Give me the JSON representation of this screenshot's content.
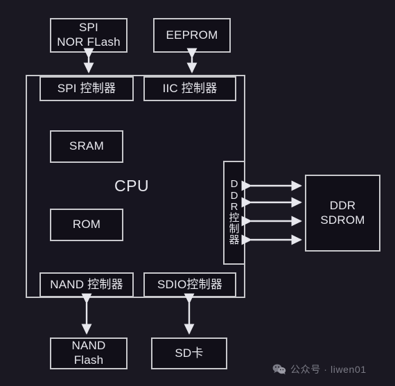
{
  "diagram": {
    "title": "SoC CPU peripheral block diagram",
    "background_color": "#1a1822",
    "line_color": "#c8c8cc",
    "text_color": "#e8e8ee",
    "cpu": {
      "label": "CPU"
    },
    "external_top": [
      {
        "id": "spi-nor-flash",
        "label": "SPI\nNOR FLash"
      },
      {
        "id": "eeprom",
        "label": "EEPROM"
      }
    ],
    "controllers_top": [
      {
        "id": "spi-controller",
        "label": "SPI 控制器"
      },
      {
        "id": "iic-controller",
        "label": "IIC 控制器"
      }
    ],
    "internal_memories": [
      {
        "id": "sram",
        "label": "SRAM"
      },
      {
        "id": "rom",
        "label": "ROM"
      }
    ],
    "ddr_controller": {
      "id": "ddr-controller",
      "chars": [
        "D",
        "D",
        "R",
        "控",
        "制",
        "器"
      ],
      "label": "DDR控制器"
    },
    "external_right": [
      {
        "id": "ddr-sdrom",
        "label": "DDR\nSDROM"
      }
    ],
    "controllers_bottom": [
      {
        "id": "nand-controller",
        "label": "NAND 控制器"
      },
      {
        "id": "sdio-controller",
        "label": "SDIO控制器"
      }
    ],
    "external_bottom": [
      {
        "id": "nand-flash",
        "label": "NAND\nFlash"
      },
      {
        "id": "sd-card",
        "label": "SD卡"
      }
    ],
    "connections": [
      {
        "from": "spi-nor-flash",
        "to": "spi-controller",
        "type": "bidirectional"
      },
      {
        "from": "eeprom",
        "to": "iic-controller",
        "type": "bidirectional"
      },
      {
        "from": "ddr-controller",
        "to": "ddr-sdrom",
        "type": "bidirectional",
        "count": 4
      },
      {
        "from": "nand-flash",
        "to": "nand-controller",
        "type": "bidirectional"
      },
      {
        "from": "sd-card",
        "to": "sdio-controller",
        "type": "bidirectional"
      }
    ]
  },
  "watermark": {
    "icon": "wechat-icon",
    "text": "公众号 · liwen01"
  }
}
